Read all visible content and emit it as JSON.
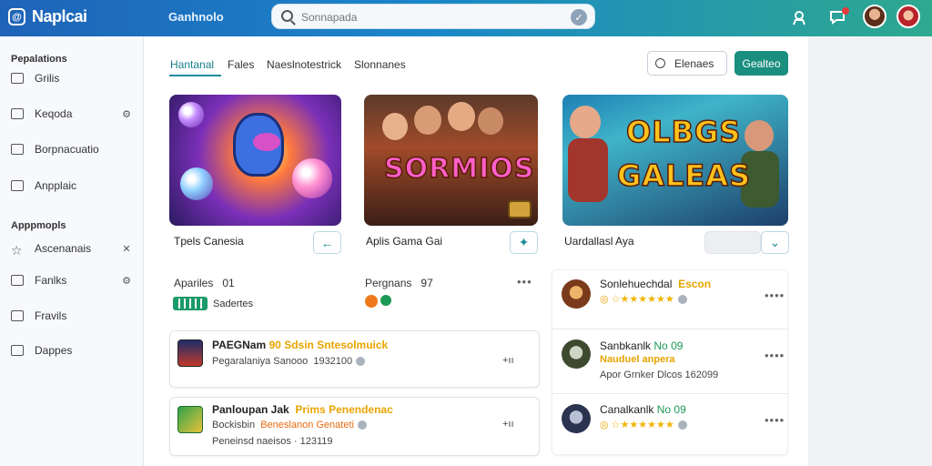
{
  "header": {
    "app_name": "Naplcai",
    "nav_link": "Ganhnolo",
    "search_placeholder": "Sonnapada",
    "logo_glyph": "@"
  },
  "sidebar": {
    "section1_title": "Pepalations",
    "section2_title": "Apppmopls",
    "items": [
      {
        "label": "Grilis"
      },
      {
        "label": "Keqoda"
      },
      {
        "label": "Borpnacuatio"
      },
      {
        "label": "Anpplaic"
      },
      {
        "label": "Ascenanais"
      },
      {
        "label": "Fanlks"
      },
      {
        "label": "Fravils"
      },
      {
        "label": "Dappes"
      }
    ]
  },
  "tabs": [
    {
      "label": "Hantanal"
    },
    {
      "label": "Fales"
    },
    {
      "label": "Naeslnotestrick"
    },
    {
      "label": "Slonnanes"
    }
  ],
  "toolbar": {
    "filter_label": "Elenaes",
    "primary_label": "Gealteo"
  },
  "cards": [
    {
      "art_text": "",
      "title": "Tpels Canesia"
    },
    {
      "art_text": "SORMIOS",
      "title": "Aplis Gama Gai"
    },
    {
      "art_text_1": "OLBGS",
      "art_text_2": "GALEAS",
      "title": "Uardallasl Aya"
    }
  ],
  "stats": {
    "left_label": "Apariles",
    "left_value": "01",
    "left_badge_text": "Sadertes",
    "mid_label": "Pergnans",
    "mid_value": "97"
  },
  "list_left": [
    {
      "title": "PAEGNam",
      "tag1": "90",
      "tag2": "Sdsin",
      "tag3": "Sntesolmuick",
      "sub": "Pegaralaniya Sanooo",
      "sub_num": "1932100",
      "action": "+ıı"
    },
    {
      "title": "Panloupan Jak",
      "tag1": "Prims",
      "tag2": "Penendenac",
      "sub": "Bockisbin",
      "sub_tag": "Beneslanon Genateti",
      "sub2": "Peneinsd naeisos · 123119",
      "action": "+ıı"
    }
  ],
  "list_right": [
    {
      "title": "Sonlehuechdal",
      "tag": "Escon",
      "more": "••••"
    },
    {
      "title": "Sanbkanlk",
      "tag": "No 09",
      "sub_tag": "Nauduel anpera",
      "sub": "Apor Grnker Dlcos 162099",
      "more": "••••"
    },
    {
      "title": "Canalkanlk",
      "tag": "No 09",
      "more": "••••"
    }
  ],
  "colors": {
    "accent": "#1b8f7f",
    "header_start": "#1f63b8",
    "header_end": "#2ea98f",
    "tag_yellow": "#e8a400",
    "tag_green": "#1d9a55"
  }
}
